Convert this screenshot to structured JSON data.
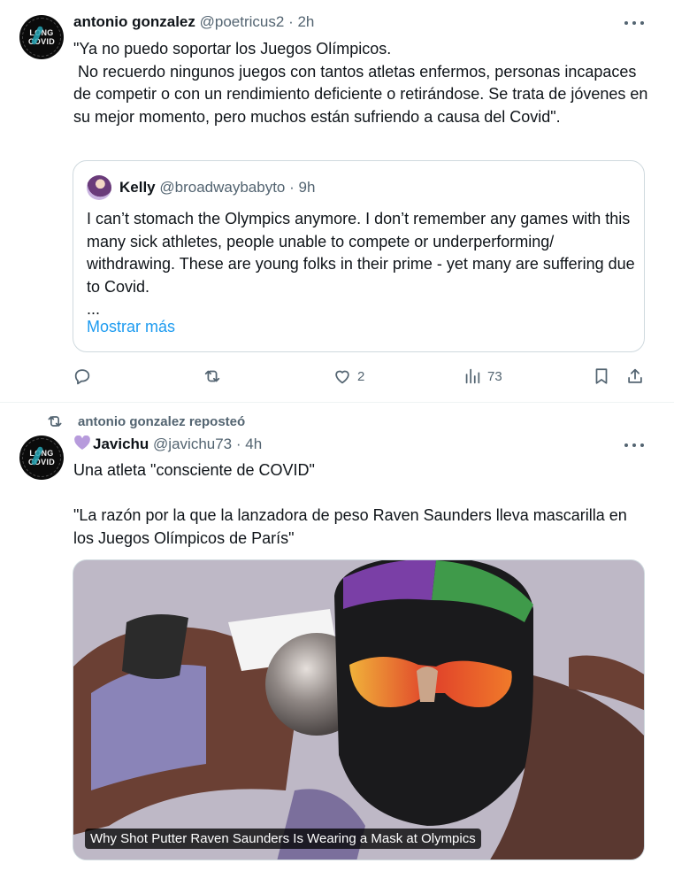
{
  "tweet1": {
    "author_name": "antonio gonzalez",
    "author_handle": "@poetricus2",
    "time": "2h",
    "avatar_text": [
      "LONG",
      "COVID"
    ],
    "text": "\"Ya no puedo soportar los Juegos Olímpicos.\n No recuerdo ningunos juegos con tantos atletas enfermos, personas incapaces de competir o con un rendimiento deficiente o retirándose. Se trata de jóvenes en su mejor momento, pero muchos están sufriendo a causa del Covid\".",
    "quote": {
      "author_name": "Kelly",
      "author_handle": "@broadwaybabyto",
      "time": "9h",
      "text": "I can’t stomach the Olympics anymore. I don’t remember any games with this many sick athletes, people unable to compete or underperforming/ withdrawing. These are young folks in their prime - yet many are suffering due to Covid.",
      "ellipsis": "...",
      "show_more": "Mostrar más"
    },
    "actions": {
      "replies": "",
      "reposts": "",
      "likes": "2",
      "views": "73"
    }
  },
  "tweet2": {
    "repost_label": "antonio gonzalez reposteó",
    "author_name": "Javichu",
    "author_handle": "@javichu73",
    "time": "4h",
    "avatar_text": [
      "LONG",
      "COVID"
    ],
    "text": "Una atleta \"consciente de COVID\"\n\n\"La razón por la que la lanzadora de peso Raven Saunders lleva mascarilla en los Juegos Olímpicos de París\"",
    "media_caption": "Why Shot Putter Raven Saunders Is Wearing a Mask at Olympics"
  },
  "separator": "·",
  "colors": {
    "text": "#0f1419",
    "muted": "#536471",
    "link": "#1d9bf0",
    "border": "#cfd9de",
    "purple_heart": "#b79bdc"
  },
  "icons": [
    "more-icon",
    "reply-icon",
    "repost-icon",
    "like-icon",
    "views-icon",
    "bookmark-icon",
    "share-icon",
    "purple-heart-icon"
  ]
}
